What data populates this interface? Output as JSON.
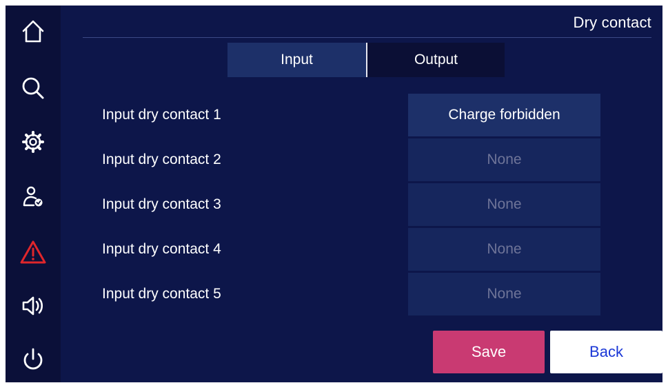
{
  "header": {
    "title": "Dry contact"
  },
  "tabs": [
    {
      "label": "Input",
      "active": true
    },
    {
      "label": "Output",
      "active": false
    }
  ],
  "rows": [
    {
      "label": "Input dry contact 1",
      "value": "Charge forbidden"
    },
    {
      "label": "Input dry contact 2",
      "value": "None"
    },
    {
      "label": "Input dry contact 3",
      "value": "None"
    },
    {
      "label": "Input dry contact 4",
      "value": "None"
    },
    {
      "label": "Input dry contact 5",
      "value": "None"
    }
  ],
  "actions": {
    "save_label": "Save",
    "back_label": "Back"
  },
  "sidebar": {
    "items": [
      {
        "icon": "home-icon"
      },
      {
        "icon": "search-icon"
      },
      {
        "icon": "gear-icon"
      },
      {
        "icon": "user-settings-icon"
      },
      {
        "icon": "warning-icon",
        "color": "#e0262b"
      },
      {
        "icon": "speaker-icon"
      },
      {
        "icon": "power-icon"
      }
    ]
  },
  "colors": {
    "background": "#0d164a",
    "sidebar": "#0b1039",
    "tab_active": "#1d3069",
    "save_button": "#c93a72",
    "back_button": "#ffffff",
    "back_text": "#1a37d6",
    "alert": "#e0262b",
    "muted_text": "#6e7498"
  }
}
